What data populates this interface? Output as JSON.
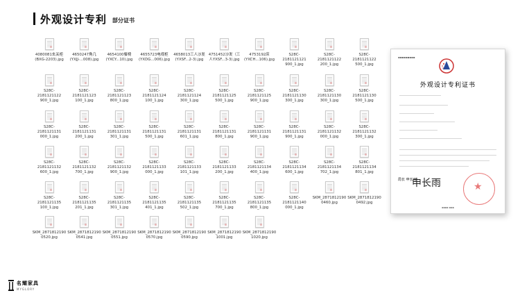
{
  "header": {
    "title": "外观设计专利",
    "subtitle": "部分证书"
  },
  "files": [
    "4080081玄关柜\n(BXG-2203).jpg",
    "4650247角几\n(YXJJ-...008).jpg",
    "4654100餐椅\n(YXCY...10).jpg",
    "4655723电视柜\n(YXDG...006).jpg",
    "4658013三人沙发\n(YXSF...2-3).jpg",
    "4751452沙发（三\n人YXSF...3-3).jpg",
    "4753192床\n(YXCH...106).jpg",
    "S28C-2181121121\n900_1.jpg",
    "S28C-2181121122\n200_1.jpg",
    "S28C-2181121122\n500_1.jpg",
    "S28C-2181121122\n900_1.jpg",
    "S28C-2181121123\n100_1.jpg",
    "S28C-2181121123\n800_1.jpg",
    "S28C-2181121124\n100_1.jpg",
    "S28C-2181121124\n300_1.jpg",
    "S28C-2181121125\n500_1.jpg",
    "S28C-2181121125\n900_1.jpg",
    "S28C-2181121130\n300_1.jpg",
    "S28C-2181121130\n300_1.jpg",
    "S28C-2181121130\n500_1.jpg",
    "S28C-2181121131\n000_1.jpg",
    "S28C-2181121131\n200_1.jpg",
    "S28C-2181121131\n301_1.jpg",
    "S28C-2181121131\n500_1.jpg",
    "S28C-2181121131\n601_1.jpg",
    "S28C-2181121131\n800_1.jpg",
    "S28C-2181121131\n900_1.jpg",
    "S28C-2181121131\n900_1.jpg",
    "S28C-2181121132\n000_1.jpg",
    "S28C-2181121132\n300_1.jpg",
    "S28C-2181121132\n600_1.jpg",
    "S28C-2181121132\n700_1.jpg",
    "S28C-2181121132\n900_1.jpg",
    "S28C-2181121133\n000_1.jpg",
    "S28C-2181121133\n101_1.jpg",
    "S28C-2181121133\n200_1.jpg",
    "S28C-2181121134\n400_1.jpg",
    "S28C-2181121134\n600_1.jpg",
    "S28C-2181121134\n702_1.jpg",
    "S28C-2181121134\n801_1.jpg",
    "S28C-2181121135\n100_1.jpg",
    "S28C-2181121135\n201_1.jpg",
    "S28C-2181121135\n301_1.jpg",
    "S28C-2181121135\n401_1.jpg",
    "S28C-2181121135\n502_1.jpg",
    "S28C-2181121135\n700_1.jpg",
    "S28C-2181121135\n800_1.jpg",
    "S28C-2181121140\n000_1.jpg",
    "SKM_2871812190\n0460.jpg",
    "SKM_2871812190\n0492.jpg",
    "SKM_2871812190\n0520.jpg",
    "SKM_2871812190\n0541.jpg",
    "SKM_2871812190\n0551.jpg",
    "SKM_2871812190\n0570.jpg",
    "SKM_2871812190\n0590.jpg",
    "SKM_2871812190\n1001.jpg",
    "SKM_2871812190\n1020.jpg"
  ],
  "certificate": {
    "title": "外观设计专利证书",
    "signature": "申长雨",
    "sign_label": "局长\n申长雨"
  },
  "brand": {
    "name_cn": "名耀家具",
    "name_en": "MYGLORY"
  },
  "colors": {
    "accent": "#111111",
    "seal": "#dd3333"
  }
}
